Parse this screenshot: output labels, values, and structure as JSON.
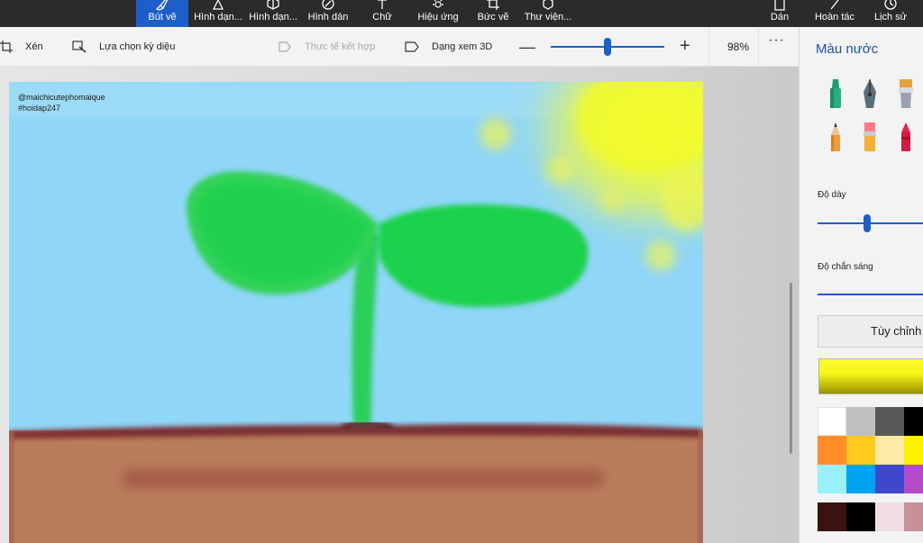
{
  "ribbon": {
    "tools": [
      {
        "label": "Bút vẽ",
        "icon": "brush-icon"
      },
      {
        "label": "Hình dạn...",
        "icon": "shapes-2d-icon"
      },
      {
        "label": "Hình dạn...",
        "icon": "shapes-3d-icon"
      },
      {
        "label": "Hình dán",
        "icon": "stickers-icon"
      },
      {
        "label": "Chữ",
        "icon": "text-icon"
      },
      {
        "label": "Hiệu ứng",
        "icon": "effects-icon"
      },
      {
        "label": "Bức vẽ",
        "icon": "canvas-icon"
      },
      {
        "label": "Thư viện...",
        "icon": "library-icon"
      },
      {
        "label": "Dán",
        "icon": "paste-icon"
      },
      {
        "label": "Hoàn tác",
        "icon": "undo-icon"
      },
      {
        "label": "Lịch sử",
        "icon": "history-icon"
      }
    ]
  },
  "toolbar": {
    "crop": "Xén",
    "magic_select": "Lựa chọn kỳ diệu",
    "mixed_reality": "Thực tế kết hợp",
    "view_3d": "Dạng xem 3D",
    "zoom": "98%",
    "zoom_level": 0.5,
    "more": "···"
  },
  "canvas": {
    "watermark_line1": "@maichicutephomaique",
    "watermark_line2": "#hoidap247"
  },
  "panel": {
    "title": "Màu nước",
    "thickness_label": "Độ dày",
    "opacity_label": "Độ chắn sáng",
    "custom_button": "Tùy chỉnh",
    "colors": {
      "row1": [
        "#ffffff",
        "#c0c0c0",
        "#585858",
        "#000000"
      ],
      "row2": [
        "#ff8c28",
        "#ffc91e",
        "#ffe9a7",
        "#fff200"
      ],
      "row3": [
        "#99f1f9",
        "#00a3f0",
        "#3f48cc",
        "#b44bc8"
      ],
      "row4": [
        "#3b1313",
        "#000000",
        "#f0dde4",
        "#c8909b"
      ]
    }
  }
}
